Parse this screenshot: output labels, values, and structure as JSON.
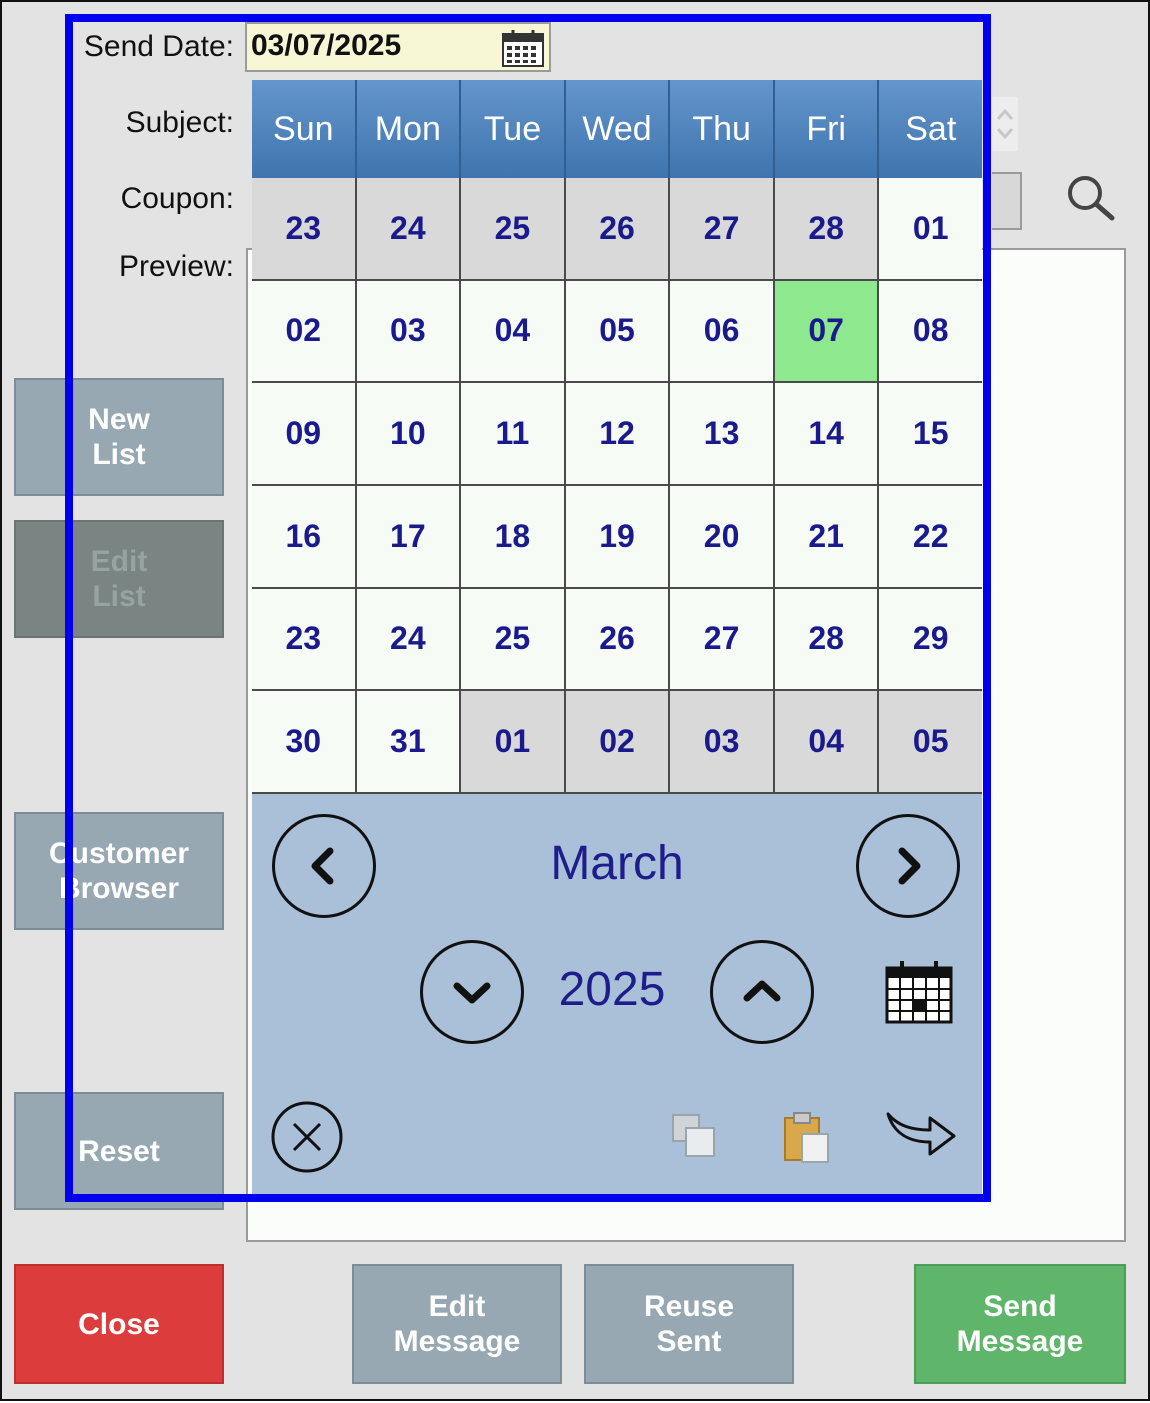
{
  "form": {
    "send_date_label": "Send Date:",
    "send_date_value": "03/07/2025",
    "subject_label": "Subject:",
    "coupon_label": "Coupon:",
    "preview_label": "Preview:"
  },
  "side_buttons": {
    "new_list_1": "New",
    "new_list_2": "List",
    "edit_list_1": "Edit",
    "edit_list_2": "List",
    "customer_browser_1": "Customer",
    "customer_browser_2": "Browser",
    "reset": "Reset"
  },
  "bottom_buttons": {
    "close": "Close",
    "edit_message_1": "Edit",
    "edit_message_2": "Message",
    "reuse_sent_1": "Reuse",
    "reuse_sent_2": "Sent",
    "send_message_1": "Send",
    "send_message_2": "Message"
  },
  "calendar": {
    "weekdays": [
      "Sun",
      "Mon",
      "Tue",
      "Wed",
      "Thu",
      "Fri",
      "Sat"
    ],
    "days": [
      {
        "d": "23",
        "other": true
      },
      {
        "d": "24",
        "other": true
      },
      {
        "d": "25",
        "other": true
      },
      {
        "d": "26",
        "other": true
      },
      {
        "d": "27",
        "other": true
      },
      {
        "d": "28",
        "other": true
      },
      {
        "d": "01",
        "other": false
      },
      {
        "d": "02",
        "other": false
      },
      {
        "d": "03",
        "other": false
      },
      {
        "d": "04",
        "other": false
      },
      {
        "d": "05",
        "other": false
      },
      {
        "d": "06",
        "other": false
      },
      {
        "d": "07",
        "other": false,
        "selected": true
      },
      {
        "d": "08",
        "other": false
      },
      {
        "d": "09",
        "other": false
      },
      {
        "d": "10",
        "other": false
      },
      {
        "d": "11",
        "other": false
      },
      {
        "d": "12",
        "other": false
      },
      {
        "d": "13",
        "other": false
      },
      {
        "d": "14",
        "other": false
      },
      {
        "d": "15",
        "other": false
      },
      {
        "d": "16",
        "other": false
      },
      {
        "d": "17",
        "other": false
      },
      {
        "d": "18",
        "other": false
      },
      {
        "d": "19",
        "other": false
      },
      {
        "d": "20",
        "other": false
      },
      {
        "d": "21",
        "other": false
      },
      {
        "d": "22",
        "other": false
      },
      {
        "d": "23",
        "other": false
      },
      {
        "d": "24",
        "other": false
      },
      {
        "d": "25",
        "other": false
      },
      {
        "d": "26",
        "other": false
      },
      {
        "d": "27",
        "other": false
      },
      {
        "d": "28",
        "other": false
      },
      {
        "d": "29",
        "other": false
      },
      {
        "d": "30",
        "other": false
      },
      {
        "d": "31",
        "other": false
      },
      {
        "d": "01",
        "other": true
      },
      {
        "d": "02",
        "other": true
      },
      {
        "d": "03",
        "other": true
      },
      {
        "d": "04",
        "other": true
      },
      {
        "d": "05",
        "other": true
      }
    ],
    "month": "March",
    "year": "2025"
  },
  "icons": {
    "date_picker": "calendar-icon",
    "search": "search-icon",
    "prev_month": "chevron-left-icon",
    "next_month": "chevron-right-icon",
    "prev_year": "chevron-down-icon",
    "next_year": "chevron-up-icon",
    "today": "calendar-icon",
    "clear": "close-icon",
    "copy": "copy-icon",
    "paste": "paste-icon",
    "apply": "forward-arrow-icon"
  },
  "colors": {
    "selected_day": "#8ee88e",
    "close_button": "#dc3c3c",
    "send_button": "#5fb66b",
    "highlight_border": "#0000ee"
  }
}
